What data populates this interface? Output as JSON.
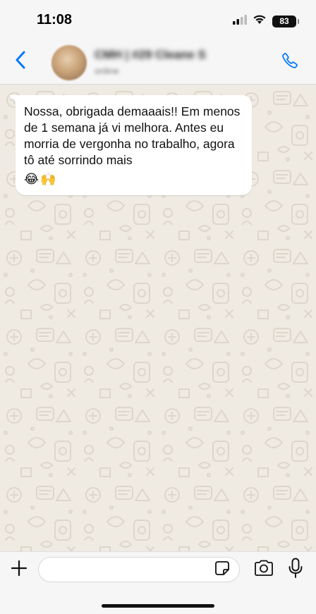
{
  "status_bar": {
    "time": "11:08",
    "battery": "83",
    "icons": [
      "cellular-signal-icon",
      "wifi-icon",
      "battery-icon"
    ]
  },
  "header": {
    "contact_name": "CMH | #29 Cleane S",
    "contact_status": "online",
    "icons": [
      "back-chevron-icon",
      "phone-icon"
    ],
    "accent_color": "#007aff"
  },
  "chat": {
    "messages": [
      {
        "direction": "incoming",
        "text": "Nossa, obrigada demaaais!! Em menos de 1 semana já vi melhora. Antes eu morria de vergonha no trabalho, agora tô até sorrindo mais",
        "emoji": "😂🙌"
      }
    ],
    "bubble_color": "#ffffff",
    "wallpaper_color": "#efeae2"
  },
  "input_bar": {
    "placeholder": "",
    "icons": [
      "plus-icon",
      "sticker-icon",
      "camera-icon",
      "microphone-icon"
    ]
  }
}
